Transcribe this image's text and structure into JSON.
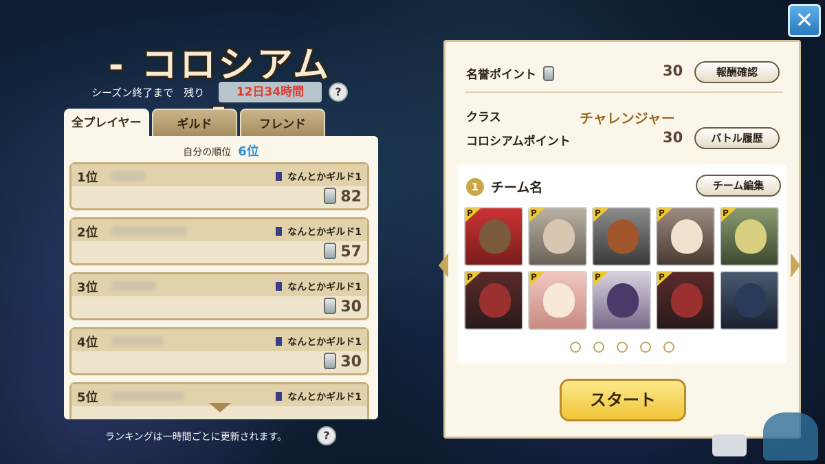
{
  "title": "- コロシアム -",
  "season": {
    "label": "シーズン終了まで　残り",
    "remaining": "12日34時間"
  },
  "tabs": [
    "全プレイヤー",
    "ギルド",
    "フレンド"
  ],
  "own_rank": {
    "label": "自分の順位",
    "value": "6位"
  },
  "rankings": [
    {
      "rank": "1位",
      "guild": "なんとかギルド1",
      "points": "82"
    },
    {
      "rank": "2位",
      "guild": "なんとかギルド1",
      "points": "57"
    },
    {
      "rank": "3位",
      "guild": "なんとかギルド1",
      "points": "30"
    },
    {
      "rank": "4位",
      "guild": "なんとかギルド1",
      "points": "30"
    },
    {
      "rank": "5位",
      "guild": "なんとかギルド1",
      "points": ""
    }
  ],
  "footer_note": "ランキングは一時間ごとに更新されます。",
  "help_glyph": "?",
  "close_glyph": "✕",
  "honor": {
    "label": "名誉ポイント",
    "value": "30",
    "button": "報酬確認"
  },
  "class_info": {
    "label": "クラス",
    "value": "チャレンジャー"
  },
  "colosseum": {
    "label": "コロシアムポイント",
    "value": "30",
    "button": "バトル履歴"
  },
  "team": {
    "number": "1",
    "name": "チーム名",
    "edit_button": "チーム編集",
    "p_badge": "P",
    "page_dots": 5
  },
  "start_button": "スタート",
  "colors": {
    "accent_gold": "#f0c53a",
    "rank_blue": "#2b8fd8",
    "timer_red": "#e23b2f"
  }
}
